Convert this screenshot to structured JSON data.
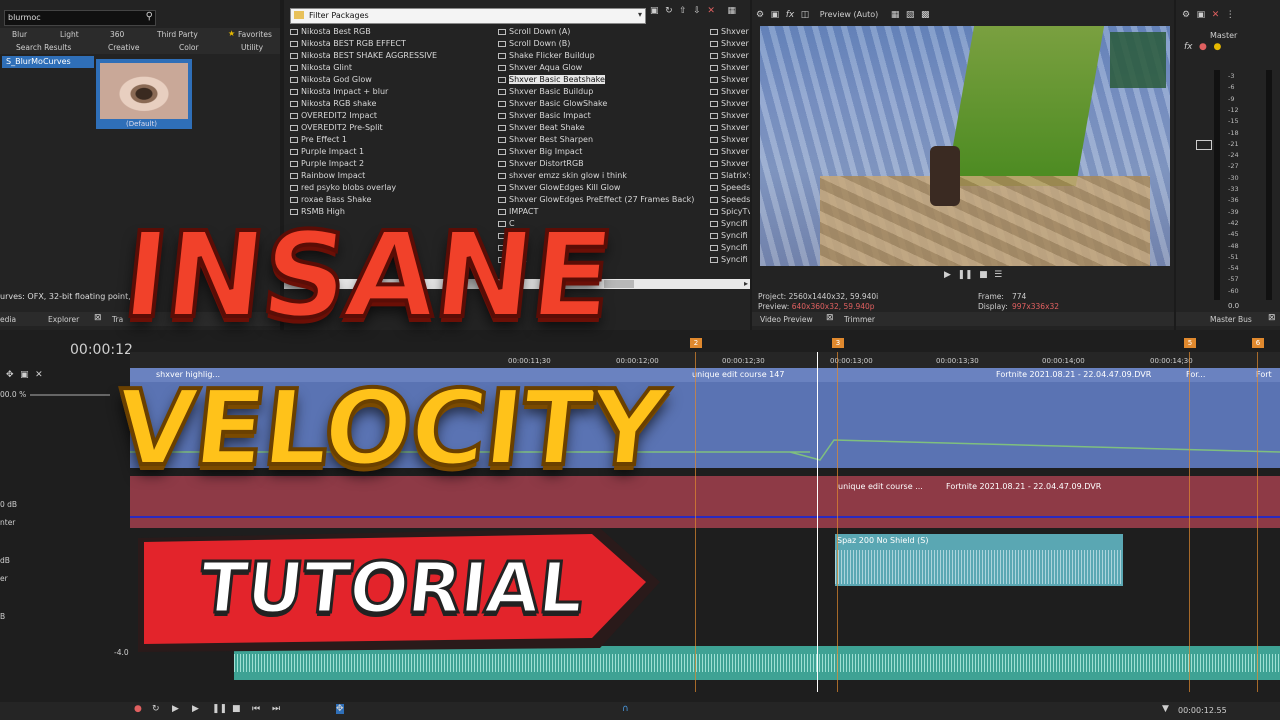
{
  "left_panel": {
    "search_value": "blurmoc",
    "tabs_row1": [
      "Blur",
      "Light",
      "360",
      "Third Party",
      "Favorites"
    ],
    "tabs_row2": [
      "Search Results",
      "Creative",
      "Color",
      "Utility"
    ],
    "tree_item": "S_BlurMoCurves",
    "preset_label": "(Default)",
    "status_text": "urves: OFX, 32-bit floating point, GP",
    "bottom_tabs": [
      "edia",
      "Explorer",
      "Tra"
    ]
  },
  "filter_packages": {
    "dropdown_label": "Filter Packages",
    "col1": [
      "Nikosta Best RGB",
      "Nikosta BEST RGB EFFECT",
      "Nikosta BEST SHAKE AGGRESSIVE",
      "Nikosta Glint",
      "Nikosta God Glow",
      "Nikosta Impact + blur",
      "Nikosta RGB shake",
      "OVEREDIT2 Impact",
      "OVEREDIT2 Pre-Split",
      "Pre Effect 1",
      "Purple Impact 1",
      "Purple Impact 2",
      "Rainbow Impact",
      "red psyko blobs overlay",
      "roxae Bass Shake",
      "RSMB High"
    ],
    "col2": [
      "Scroll Down (A)",
      "Scroll Down (B)",
      "Shake Flicker Buildup",
      "Shxver Aqua Glow",
      "Shxver Basic Beatshake",
      "Shxver Basic Buildup",
      "Shxver Basic GlowShake",
      "Shxver Basic Impact",
      "Shxver Beat Shake",
      "Shxver Best Sharpen",
      "Shxver Big Impact",
      "Shxver DistortRGB",
      "shxver emzz skin glow i think",
      "Shxver GlowEdges Kill Glow",
      "Shxver GlowEdges PreEffect (27 Frames Back)",
      "IMPACT",
      "C",
      "",
      "pact",
      "pact"
    ],
    "col3": [
      "Shxver",
      "Shxver",
      "Shxver",
      "Shxver",
      "Shxver",
      "Shxver",
      "Shxver",
      "Shxver",
      "Shxver",
      "Shxver",
      "Shxver",
      "Shxver",
      "Slatrix's",
      "Speeds",
      "Speeds",
      "SpicyTv",
      "Syncifi",
      "Syncifi",
      "Syncifi",
      "Syncifi"
    ],
    "selected": "Shxver Basic Beatshake"
  },
  "preview": {
    "toolbar_label": "Preview (Auto)",
    "project_label": "Project:",
    "project_value": "2560x1440x32, 59.940i",
    "preview_label": "Preview:",
    "preview_value": "640x360x32, 59.940p",
    "frame_label": "Frame:",
    "frame_value": "774",
    "display_label": "Display:",
    "display_value": "997x336x32",
    "tabs": [
      "Video Preview",
      "Trimmer"
    ]
  },
  "master": {
    "title": "Master",
    "scale": [
      "3",
      "6",
      "9",
      "12",
      "15",
      "18",
      "21",
      "24",
      "27",
      "30",
      "33",
      "36",
      "39",
      "42",
      "45",
      "48",
      "51",
      "54",
      "57",
      "60"
    ],
    "bottom_tab": "Master Bus",
    "zero_a": "0.0",
    "zero_b": "0.0"
  },
  "timeline": {
    "timecode": "00:00:12",
    "ruler": [
      "00:00:11;30",
      "00:00:12;00",
      "00:00:12;30",
      "00:00:13;00",
      "00:00:13;30",
      "00:00:14;00",
      "00:00:14;30"
    ],
    "markers": [
      "2",
      "3",
      "5",
      "6"
    ],
    "level": "00.0 %",
    "db_labels": [
      "0 dB",
      "dB",
      "-4.0"
    ],
    "track_misc": [
      "nter",
      "er",
      "B"
    ],
    "clips": {
      "v1a": "shxver highlig...",
      "v1b": "unique edit course 147",
      "v1c": "Fortnite 2021.08.21 - 22.04.47.09.DVR",
      "v1d": "For...",
      "v1e": "Fort",
      "v2a": "unique edit course ...",
      "v2b": "Fortnite 2021.08.21 - 22.04.47.09.DVR",
      "a1": "Spaz 200 No Shield (S)"
    },
    "end_time": "00:00:12.55"
  },
  "overlay": {
    "line1": "INSANE",
    "line2": "VELOCITY",
    "line3": "TUTORIAL"
  },
  "colors": {
    "video_track": "#5a73b3",
    "video2_track": "#8e3a46",
    "audio_clip": "#5aa7b3",
    "audio_bottom": "#3ea294",
    "accent": "#e0892e"
  }
}
